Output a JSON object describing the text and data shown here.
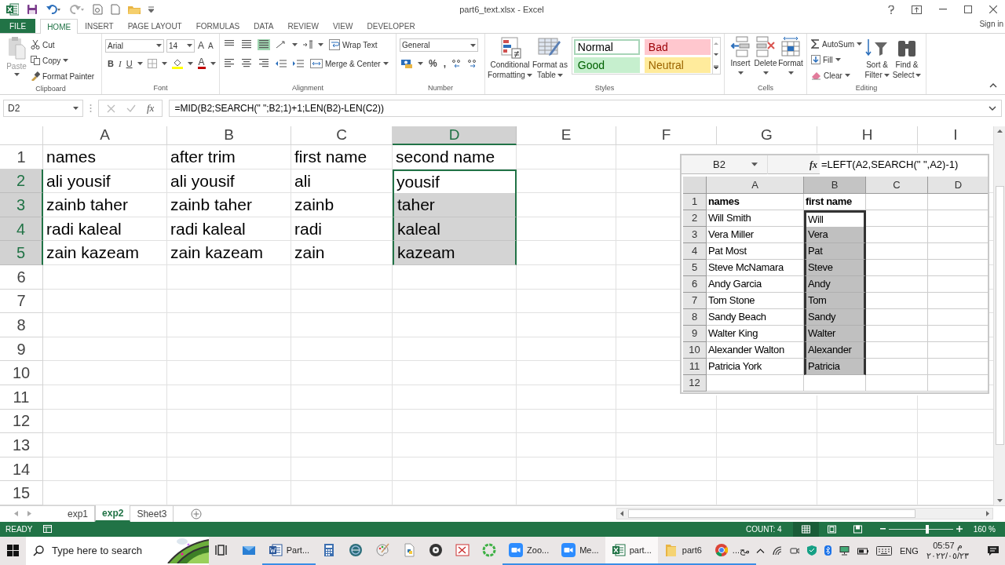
{
  "window": {
    "title": "part6_text.xlsx - Excel",
    "account": "Sign in"
  },
  "ribbon_tabs": [
    {
      "label": "FILE",
      "kind": "file",
      "selected": false
    },
    {
      "label": "HOME",
      "kind": "tab",
      "selected": true
    },
    {
      "label": "INSERT",
      "kind": "tab",
      "selected": false
    },
    {
      "label": "PAGE LAYOUT",
      "kind": "tab",
      "selected": false
    },
    {
      "label": "FORMULAS",
      "kind": "tab",
      "selected": false
    },
    {
      "label": "DATA",
      "kind": "tab",
      "selected": false
    },
    {
      "label": "REVIEW",
      "kind": "tab",
      "selected": false
    },
    {
      "label": "VIEW",
      "kind": "tab",
      "selected": false
    },
    {
      "label": "DEVELOPER",
      "kind": "tab",
      "selected": false
    }
  ],
  "clipboard": {
    "paste": "Paste",
    "cut": "Cut",
    "copy": "Copy",
    "format_painter": "Format Painter",
    "label": "Clipboard"
  },
  "font": {
    "name": "Arial",
    "size": "14",
    "grow": "A",
    "shrink": "A",
    "styles": [
      "B",
      "I",
      "U"
    ],
    "font_color": "A",
    "label": "Font"
  },
  "alignment": {
    "wrap_text": "Wrap Text",
    "merge": "Merge & Center",
    "label": "Alignment"
  },
  "number": {
    "format": "General",
    "symbols": [
      "%",
      ","
    ],
    "label": "Number"
  },
  "styles": {
    "conditional": [
      "Conditional",
      "Formatting"
    ],
    "format_table": [
      "Format as",
      "Table"
    ],
    "cell_styles": [
      {
        "label": "Normal",
        "kind": "normal"
      },
      {
        "label": "Bad",
        "kind": "bad"
      },
      {
        "label": "Good",
        "kind": "good"
      },
      {
        "label": "Neutral",
        "kind": "neutral"
      }
    ],
    "label": "Styles"
  },
  "cells": {
    "buttons": [
      "Insert",
      "Delete",
      "Format"
    ],
    "label": "Cells"
  },
  "editing": {
    "autosum": "AutoSum",
    "fill": "Fill",
    "clear": "Clear",
    "sort": [
      "Sort &",
      "Filter"
    ],
    "find": [
      "Find &",
      "Select"
    ],
    "label": "Editing"
  },
  "formula_bar": {
    "name_box": "D2",
    "function_button": "fx",
    "formula": "=MID(B2;SEARCH(\" \";B2;1)+1;LEN(B2)-LEN(C2))"
  },
  "sheet": {
    "columns": [
      {
        "label": "A",
        "selected": false
      },
      {
        "label": "B",
        "selected": false
      },
      {
        "label": "C",
        "selected": false
      },
      {
        "label": "D",
        "selected": true
      },
      {
        "label": "E",
        "selected": false
      },
      {
        "label": "F",
        "selected": false
      },
      {
        "label": "G",
        "selected": false
      },
      {
        "label": "H",
        "selected": false
      },
      {
        "label": "I",
        "selected": false
      }
    ],
    "rows": [
      {
        "number": "1",
        "selected": false,
        "cells": [
          {
            "text": "names",
            "selected": false,
            "active": false
          },
          {
            "text": "after trim",
            "selected": false,
            "active": false
          },
          {
            "text": "first name",
            "selected": false,
            "active": false
          },
          {
            "text": "second name",
            "selected": false,
            "active": false
          }
        ]
      },
      {
        "number": "2",
        "selected": true,
        "cells": [
          {
            "text": "ali yousif",
            "selected": false,
            "active": false
          },
          {
            "text": "ali yousif",
            "selected": false,
            "active": false
          },
          {
            "text": "ali",
            "selected": false,
            "active": false
          },
          {
            "text": "yousif",
            "selected": true,
            "active": true
          }
        ]
      },
      {
        "number": "3",
        "selected": true,
        "cells": [
          {
            "text": "zainb taher",
            "selected": false,
            "active": false
          },
          {
            "text": "zainb taher",
            "selected": false,
            "active": false
          },
          {
            "text": "zainb",
            "selected": false,
            "active": false
          },
          {
            "text": "taher",
            "selected": true,
            "active": false
          }
        ]
      },
      {
        "number": "4",
        "selected": true,
        "cells": [
          {
            "text": "radi kaleal",
            "selected": false,
            "active": false
          },
          {
            "text": "radi kaleal",
            "selected": false,
            "active": false
          },
          {
            "text": "radi",
            "selected": false,
            "active": false
          },
          {
            "text": "kaleal",
            "selected": true,
            "active": false
          }
        ]
      },
      {
        "number": "5",
        "selected": true,
        "cells": [
          {
            "text": "zain kazeam",
            "selected": false,
            "active": false
          },
          {
            "text": "zain kazeam",
            "selected": false,
            "active": false
          },
          {
            "text": "zain",
            "selected": false,
            "active": false
          },
          {
            "text": "kazeam",
            "selected": true,
            "active": false
          }
        ]
      },
      {
        "number": "6",
        "selected": false
      },
      {
        "number": "7",
        "selected": false
      },
      {
        "number": "8",
        "selected": false
      },
      {
        "number": "9",
        "selected": false
      },
      {
        "number": "10",
        "selected": false
      },
      {
        "number": "11",
        "selected": false
      },
      {
        "number": "12",
        "selected": false
      },
      {
        "number": "13",
        "selected": false
      },
      {
        "number": "14",
        "selected": false
      },
      {
        "number": "15",
        "selected": false
      }
    ]
  },
  "embedded_screenshot": {
    "name_box": "B2",
    "function_button": "fx",
    "formula": "=LEFT(A2,SEARCH(\" \",A2)-1)",
    "columns": [
      {
        "label": "A",
        "selected": false
      },
      {
        "label": "B",
        "selected": true
      },
      {
        "label": "C",
        "selected": false
      },
      {
        "label": "D",
        "selected": false
      }
    ],
    "rows": [
      {
        "number": "1",
        "kind": "header",
        "cells": [
          {
            "text": "names",
            "selected": false,
            "active": false
          },
          {
            "text": "first name",
            "selected": false,
            "active": false
          }
        ]
      },
      {
        "number": "2",
        "kind": "data",
        "cells": [
          {
            "text": "Will Smith",
            "selected": false,
            "active": false
          },
          {
            "text": "Will",
            "selected": true,
            "active": true
          }
        ]
      },
      {
        "number": "3",
        "kind": "data",
        "cells": [
          {
            "text": "Vera Miller",
            "selected": false,
            "active": false
          },
          {
            "text": "Vera",
            "selected": true,
            "active": false
          }
        ]
      },
      {
        "number": "4",
        "kind": "data",
        "cells": [
          {
            "text": "Pat Most",
            "selected": false,
            "active": false
          },
          {
            "text": "Pat",
            "selected": true,
            "active": false
          }
        ]
      },
      {
        "number": "5",
        "kind": "data",
        "cells": [
          {
            "text": "Steve McNamara",
            "selected": false,
            "active": false
          },
          {
            "text": "Steve",
            "selected": true,
            "active": false
          }
        ]
      },
      {
        "number": "6",
        "kind": "data",
        "cells": [
          {
            "text": "Andy Garcia",
            "selected": false,
            "active": false
          },
          {
            "text": "Andy",
            "selected": true,
            "active": false
          }
        ]
      },
      {
        "number": "7",
        "kind": "data",
        "cells": [
          {
            "text": "Tom Stone",
            "selected": false,
            "active": false
          },
          {
            "text": "Tom",
            "selected": true,
            "active": false
          }
        ]
      },
      {
        "number": "8",
        "kind": "data",
        "cells": [
          {
            "text": "Sandy Beach",
            "selected": false,
            "active": false
          },
          {
            "text": "Sandy",
            "selected": true,
            "active": false
          }
        ]
      },
      {
        "number": "9",
        "kind": "data",
        "cells": [
          {
            "text": "Walter King",
            "selected": false,
            "active": false
          },
          {
            "text": "Walter",
            "selected": true,
            "active": false
          }
        ]
      },
      {
        "number": "10",
        "kind": "data",
        "cells": [
          {
            "text": "Alexander Walton",
            "selected": false,
            "active": false
          },
          {
            "text": "Alexander",
            "selected": true,
            "active": false
          }
        ]
      },
      {
        "number": "11",
        "kind": "data",
        "cells": [
          {
            "text": "Patricia York",
            "selected": false,
            "active": false
          },
          {
            "text": "Patricia",
            "selected": true,
            "active": false
          }
        ]
      },
      {
        "number": "12",
        "kind": "data"
      }
    ]
  },
  "sheet_tabs": [
    {
      "label": "exp1",
      "selected": false
    },
    {
      "label": "exp2",
      "selected": true
    },
    {
      "label": "Sheet3",
      "selected": false
    }
  ],
  "status_bar": {
    "mode": "READY",
    "count": "COUNT: 4",
    "views": [
      {
        "kind": "normal",
        "selected": true
      },
      {
        "kind": "layout",
        "selected": false
      },
      {
        "kind": "break",
        "selected": false
      }
    ],
    "zoom_slider": {
      "level": 0.6
    },
    "zoom": "160 %"
  },
  "taskbar": {
    "search_placeholder": "Type here to search",
    "apps": [
      {
        "kind": "taskview",
        "running": false,
        "selected": false
      },
      {
        "kind": "mail",
        "running": false,
        "selected": false
      },
      {
        "kind": "word",
        "label": "Part...",
        "running": true,
        "selected": false
      },
      {
        "kind": "calculator",
        "running": false,
        "selected": false
      },
      {
        "kind": "globe",
        "running": false,
        "selected": false
      },
      {
        "kind": "paint",
        "running": false,
        "selected": false
      },
      {
        "kind": "python",
        "running": false,
        "selected": false
      },
      {
        "kind": "disc",
        "running": false,
        "selected": false
      },
      {
        "kind": "snip",
        "running": false,
        "selected": false
      },
      {
        "kind": "ring",
        "running": false,
        "selected": false
      },
      {
        "kind": "zoom",
        "label": "Zoo...",
        "running": true,
        "selected": false
      },
      {
        "kind": "zoom",
        "label": "Me...",
        "running": true,
        "selected": false
      },
      {
        "kind": "excel",
        "label": "part...",
        "running": true,
        "selected": true
      },
      {
        "kind": "folder",
        "label": "part6",
        "running": true,
        "selected": false
      },
      {
        "kind": "chrome",
        "label": "...مح",
        "running": true,
        "selected": false
      }
    ],
    "language": "ENG",
    "time": "05:57 م",
    "date": "٢٠٢٢/٠٥/٢٣"
  }
}
